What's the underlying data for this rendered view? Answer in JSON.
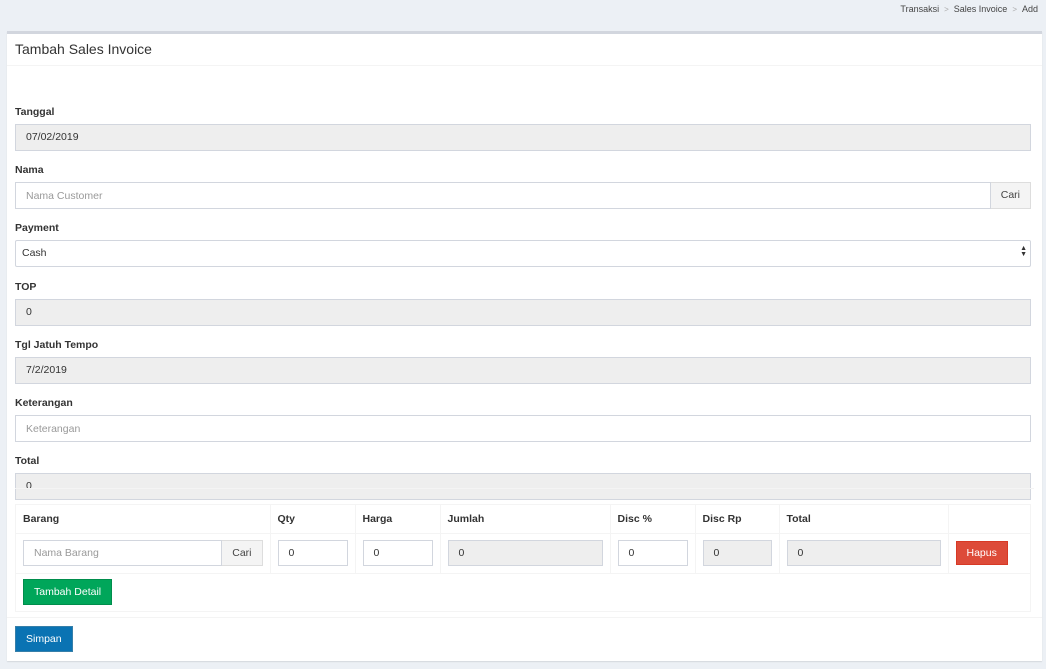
{
  "breadcrumb": [
    "Transaksi",
    "Sales Invoice",
    "Add"
  ],
  "title": "Tambah Sales Invoice",
  "form": {
    "tanggal": {
      "label": "Tanggal",
      "value": "07/02/2019"
    },
    "nama": {
      "label": "Nama",
      "placeholder": "Nama Customer",
      "button": "Cari"
    },
    "payment": {
      "label": "Payment",
      "value": "Cash"
    },
    "top": {
      "label": "TOP",
      "value": "0"
    },
    "jatuh_tempo": {
      "label": "Tgl Jatuh Tempo",
      "value": "7/2/2019"
    },
    "keterangan": {
      "label": "Keterangan",
      "placeholder": "Keterangan"
    },
    "total": {
      "label": "Total",
      "value": "0"
    }
  },
  "detail": {
    "headers": [
      "Barang",
      "Qty",
      "Harga",
      "Jumlah",
      "Disc %",
      "Disc Rp",
      "Total"
    ],
    "row": {
      "barang_placeholder": "Nama Barang",
      "cari": "Cari",
      "qty": "0",
      "harga": "0",
      "jumlah": "0",
      "disc_pct": "0",
      "disc_rp": "0",
      "total": "0",
      "hapus": "Hapus"
    },
    "add_button": "Tambah Detail"
  },
  "footer": {
    "save_button": "Simpan"
  },
  "colors": {
    "danger": "#dd4b39",
    "success": "#00a65a",
    "primary": "#0a73b3"
  }
}
